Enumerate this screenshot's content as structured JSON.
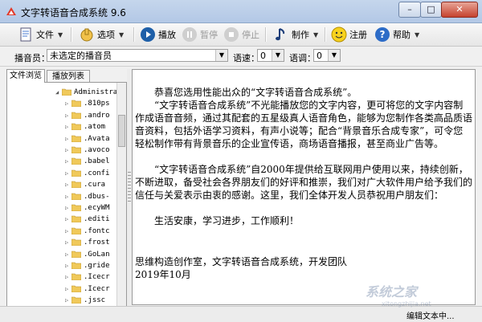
{
  "window": {
    "title": "文字转语音合成系统 9.6",
    "close": "✕",
    "max": "□",
    "min": "–"
  },
  "toolbar": {
    "file": "文件",
    "options": "选项",
    "play": "播放",
    "pause": "暂停",
    "stop": "停止",
    "produce": "制作",
    "register": "注册",
    "help": "帮助"
  },
  "options_bar": {
    "announcer_label": "播音员：",
    "announcer_value": "未选定的播音员",
    "speed_label": "语速：",
    "speed_value": "0",
    "pitch_label": "语调：",
    "pitch_value": "0"
  },
  "tabs": [
    "文件浏览",
    "播放列表"
  ],
  "tree": {
    "root": "Administrat",
    "items": [
      ".810ps",
      ".andro",
      ".atom",
      ".Avata",
      ".avoco",
      ".babel",
      ".confi",
      ".cura",
      ".dbus-",
      ".ecyWM",
      ".editi",
      ".fontc",
      ".frost",
      ".GoLan",
      ".gride",
      ".Icecr",
      ".Icecr",
      ".jssc"
    ]
  },
  "editor": {
    "p1": "恭喜您选用性能出众的“文字转语音合成系统”。",
    "p2": "“文字转语音合成系统”不光能播放您的文字内容，更可将您的文字内容制作成语音音频，通过其配套的五星级真人语音角色，能够为您制作各类高品质语音资料，包括外语学习资料，有声小说等；配合“背景音乐合成专家”，可令您轻松制作带有背景音乐的企业宣传语，商场语音播报，甚至商业广告等。",
    "p3": "“文字转语音合成系统”自2000年提供给互联网用户使用以来，持续创新，不断进取，备受社会各界朋友们的好评和推崇，我们对广大软件用户给予我们的信任与关爱表示由衷的感谢。这里，我们全体开发人员恭祝用户朋友们：",
    "p4": "生活安康，学习进步，工作顺利！",
    "signature": "思维构造创作室，文字转语音合成系统，开发团队",
    "date": "2019年10月"
  },
  "status": {
    "text": "编辑文本中..."
  },
  "watermark": {
    "text": "系统之家",
    "url": "xitongzhijia.net"
  },
  "colors": {
    "accent": "#1e5fa8",
    "title_bg": "#c0d2ea",
    "close_btn": "#c5422e"
  }
}
